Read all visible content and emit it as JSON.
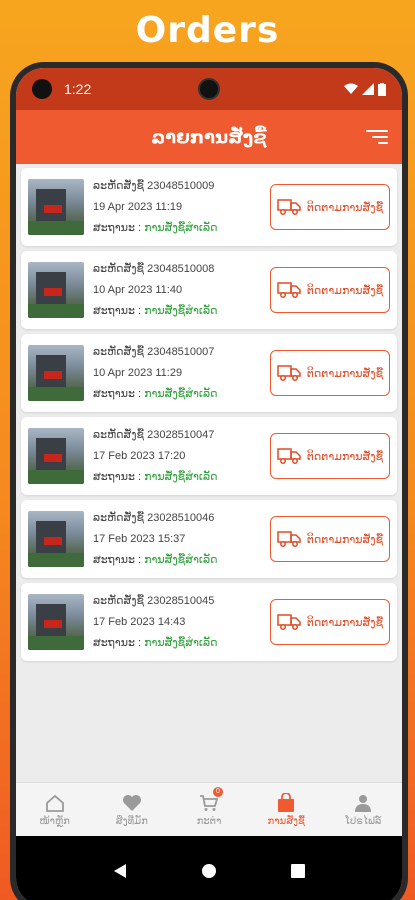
{
  "promo": {
    "title": "Orders"
  },
  "status_bar": {
    "time": "1:22"
  },
  "header": {
    "title": "ລາຍການສັ່ງຊື້"
  },
  "orders": [
    {
      "order_label": "ລະຫັດສັ່ງຊື້",
      "order_no": "23048510009",
      "date": "19 Apr 2023  11:19",
      "status_label": "ສະຖານະ :",
      "status_value": "ການສັ່ງຊື້ສຳເລັດ",
      "track_label": "ຕິດຕາມການສັ່ງຊື້"
    },
    {
      "order_label": "ລະຫັດສັ່ງຊື້",
      "order_no": "23048510008",
      "date": "10 Apr 2023  11:40",
      "status_label": "ສະຖານະ :",
      "status_value": "ການສັ່ງຊື້ສຳເລັດ",
      "track_label": "ຕິດຕາມການສັ່ງຊື້"
    },
    {
      "order_label": "ລະຫັດສັ່ງຊື້",
      "order_no": "23048510007",
      "date": "10 Apr 2023  11:29",
      "status_label": "ສະຖານະ :",
      "status_value": "ການສັ່ງຊື້ສຳເລັດ",
      "track_label": "ຕິດຕາມການສັ່ງຊື້"
    },
    {
      "order_label": "ລະຫັດສັ່ງຊື້",
      "order_no": "23028510047",
      "date": "17 Feb 2023  17:20",
      "status_label": "ສະຖານະ :",
      "status_value": "ການສັ່ງຊື້ສຳເລັດ",
      "track_label": "ຕິດຕາມການສັ່ງຊື້"
    },
    {
      "order_label": "ລະຫັດສັ່ງຊື້",
      "order_no": "23028510046",
      "date": "17 Feb 2023  15:37",
      "status_label": "ສະຖານະ :",
      "status_value": "ການສັ່ງຊື້ສຳເລັດ",
      "track_label": "ຕິດຕາມການສັ່ງຊື້"
    },
    {
      "order_label": "ລະຫັດສັ່ງຊື້",
      "order_no": "23028510045",
      "date": "17 Feb 2023  14:43",
      "status_label": "ສະຖານະ :",
      "status_value": "ການສັ່ງຊື້ສຳເລັດ",
      "track_label": "ຕິດຕາມການສັ່ງຊື້"
    }
  ],
  "bottom_nav": [
    {
      "label": "ໜ້າຫຼັກ",
      "icon": "home-icon"
    },
    {
      "label": "ສິ່ງທີ່ມັກ",
      "icon": "heart-icon"
    },
    {
      "label": "ກະຕ່າ",
      "icon": "cart-icon",
      "badge": "0"
    },
    {
      "label": "ການສັ່ງຊື້",
      "icon": "shopping-bag-icon",
      "active": true
    },
    {
      "label": "ໂປຣໄຟລ໌",
      "icon": "profile-icon"
    }
  ],
  "colors": {
    "primary": "#ef5a30",
    "status_bar": "#c23a1a",
    "success": "#2e9e3a"
  }
}
